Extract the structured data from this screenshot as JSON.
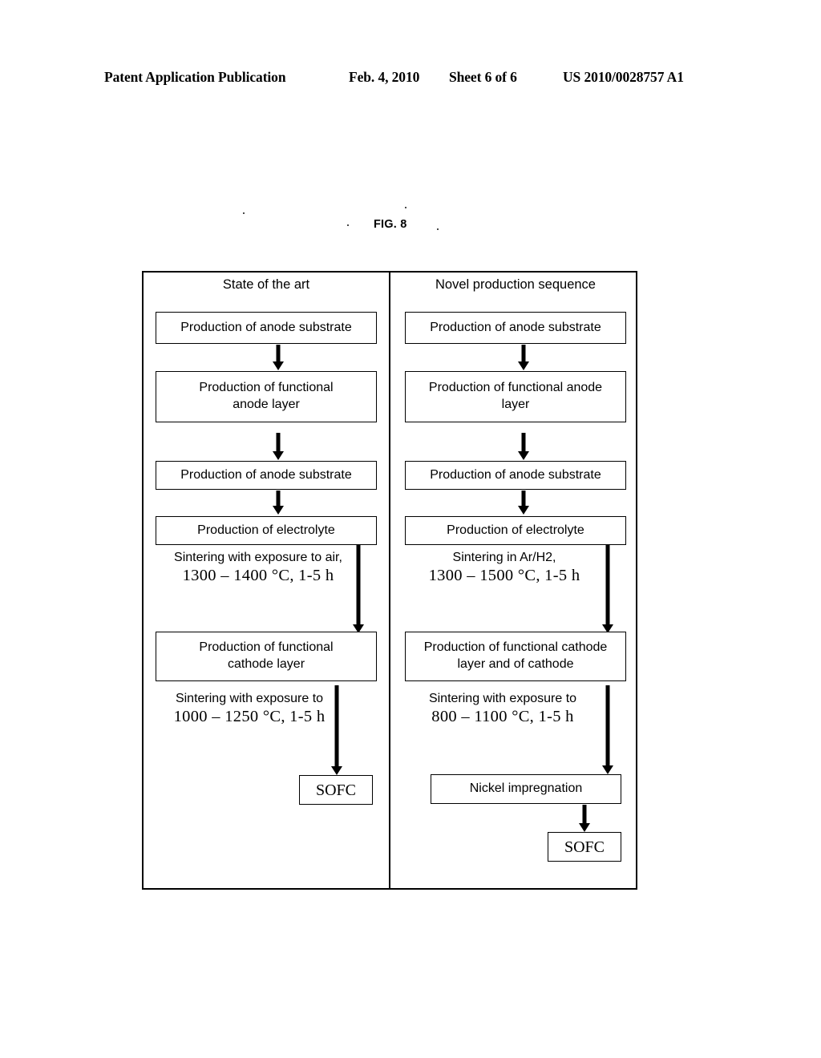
{
  "header": {
    "publication": "Patent Application Publication",
    "date": "Feb. 4, 2010",
    "sheet": "Sheet 6 of 6",
    "patent_number": "US 2010/0028757 A1"
  },
  "figure": {
    "caption": "FIG. 8"
  },
  "diagram": {
    "columns": [
      {
        "id": "state-of-the-art",
        "title": "State of the art",
        "steps": [
          {
            "type": "box",
            "label": "Production of anode substrate"
          },
          {
            "type": "box",
            "label": "Production of functional anode layer"
          },
          {
            "type": "box",
            "label": "Production of anode substrate"
          },
          {
            "type": "box",
            "label": "Production of electrolyte"
          },
          {
            "type": "label",
            "line1": "Sintering with exposure to air,",
            "line2": "1300 – 1400 °C, 1-5 h"
          },
          {
            "type": "box",
            "label": "Production of functional cathode layer"
          },
          {
            "type": "label",
            "line1": "Sintering with exposure to",
            "line2": "1000 – 1250 °C, 1-5 h"
          },
          {
            "type": "box",
            "label": "SOFC"
          }
        ]
      },
      {
        "id": "novel-production-sequence",
        "title": "Novel production sequence",
        "steps": [
          {
            "type": "box",
            "label": "Production of anode substrate"
          },
          {
            "type": "box",
            "label": "Production of functional anode layer"
          },
          {
            "type": "box",
            "label": "Production of anode substrate"
          },
          {
            "type": "box",
            "label": "Production of electrolyte"
          },
          {
            "type": "label",
            "line1": "Sintering in Ar/H2,",
            "line2": "1300 – 1500 °C, 1-5 h"
          },
          {
            "type": "box",
            "label": "Production of functional cathode layer and of cathode"
          },
          {
            "type": "label",
            "line1": "Sintering with exposure to",
            "line2": "800 – 1100 °C, 1-5 h"
          },
          {
            "type": "box",
            "label": "Nickel impregnation"
          },
          {
            "type": "box",
            "label": "SOFC"
          }
        ]
      }
    ]
  },
  "text": {
    "l_box1": "Production of anode substrate",
    "l_box2_line1": "Production of functional",
    "l_box2_line2": "anode layer",
    "l_box3": "Production of anode substrate",
    "l_box4": "Production of electrolyte",
    "l_sint1_line1": "Sintering with exposure to air,",
    "l_sint1_line2": "1300 – 1400 °C, 1-5 h",
    "l_box5_line1": "Production of functional",
    "l_box5_line2": "cathode layer",
    "l_sint2_line1": "Sintering with exposure to",
    "l_sint2_line2": "1000 – 1250 °C, 1-5 h",
    "l_box6": "SOFC",
    "r_box1": "Production of anode substrate",
    "r_box2_line1": "Production of functional anode",
    "r_box2_line2": "layer",
    "r_box3": "Production of anode substrate",
    "r_box4": "Production of electrolyte",
    "r_sint1_line1": "Sintering in Ar/H2,",
    "r_sint1_line2": "1300 – 1500 °C, 1-5 h",
    "r_box5_line1": "Production of functional cathode",
    "r_box5_line2": "layer and of cathode",
    "r_sint2_line1": "Sintering with exposure to",
    "r_sint2_line2": "800 – 1100 °C, 1-5 h",
    "r_box6": "Nickel impregnation",
    "r_box7": "SOFC"
  },
  "colors": {
    "ink": "#000000",
    "page": "#ffffff"
  }
}
